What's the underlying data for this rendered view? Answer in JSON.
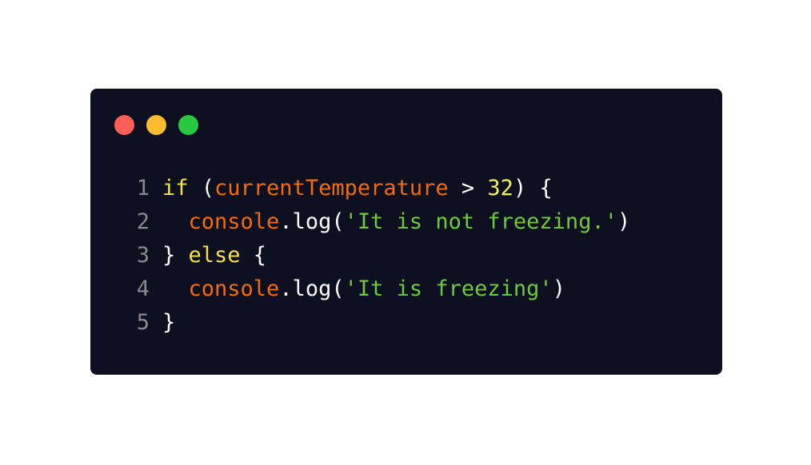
{
  "window": {
    "controls": [
      {
        "name": "close",
        "color": "#ff5f57"
      },
      {
        "name": "minimize",
        "color": "#febc2e"
      },
      {
        "name": "maximize",
        "color": "#28c840"
      }
    ]
  },
  "code": {
    "lines": [
      {
        "number": "1",
        "tokens": [
          {
            "type": "kw",
            "text": "if"
          },
          {
            "type": "plain",
            "text": " ("
          },
          {
            "type": "var",
            "text": "currentTemperature"
          },
          {
            "type": "plain",
            "text": " > "
          },
          {
            "type": "num",
            "text": "32"
          },
          {
            "type": "plain",
            "text": ") {"
          }
        ]
      },
      {
        "number": "2",
        "tokens": [
          {
            "type": "plain",
            "text": "  "
          },
          {
            "type": "var",
            "text": "console"
          },
          {
            "type": "plain",
            "text": ".log("
          },
          {
            "type": "str",
            "text": "'It is not freezing.'"
          },
          {
            "type": "plain",
            "text": ")"
          }
        ]
      },
      {
        "number": "3",
        "tokens": [
          {
            "type": "plain",
            "text": "} "
          },
          {
            "type": "kw",
            "text": "else"
          },
          {
            "type": "plain",
            "text": " {"
          }
        ]
      },
      {
        "number": "4",
        "tokens": [
          {
            "type": "plain",
            "text": "  "
          },
          {
            "type": "var",
            "text": "console"
          },
          {
            "type": "plain",
            "text": ".log("
          },
          {
            "type": "str",
            "text": "'It is freezing'"
          },
          {
            "type": "plain",
            "text": ")"
          }
        ]
      },
      {
        "number": "5",
        "tokens": [
          {
            "type": "plain",
            "text": "}"
          }
        ]
      }
    ]
  }
}
